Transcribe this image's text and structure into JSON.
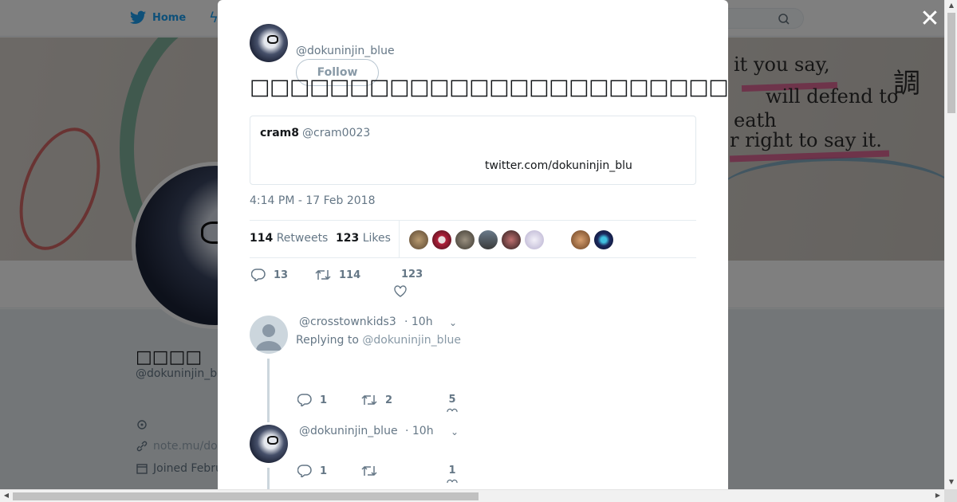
{
  "nav": {
    "home_label": "Home"
  },
  "profile": {
    "name": "□□□□",
    "handle": "@dokuninjin_b",
    "website": "note.mu/do",
    "joined": "Joined Febru"
  },
  "modal": {
    "author_handle": "@dokuninjin_blue",
    "follow_label": "Follow",
    "tweet_text": "□□□□□□□□□□□□□□□□□□□□□□□□□□□□□□□□□□□□□□□□□□□□□□",
    "quote": {
      "name": "cram8",
      "handle": "@cram0023",
      "link": "twitter.com/dokuninjin_blu"
    },
    "timestamp": "4:14 PM - 17 Feb 2018",
    "stats": {
      "retweets_count": "114",
      "retweets_label": "Retweets",
      "likes_count": "123",
      "likes_label": "Likes"
    },
    "actions": {
      "replies": "13",
      "retweets": "114",
      "likes": "123"
    },
    "replies": [
      {
        "handle": "@crosstownkids3",
        "time": "· 10h",
        "replying_prefix": "Replying to",
        "replying_to": "@dokuninjin_blue",
        "replies": "1",
        "retweets": "2",
        "likes": "5"
      },
      {
        "handle": "@dokuninjin_blue",
        "time": "· 10h",
        "replies": "1",
        "likes": "1"
      }
    ]
  },
  "colors": {
    "accent": "#1da1f2",
    "muted": "#657786",
    "text": "#14171a"
  }
}
